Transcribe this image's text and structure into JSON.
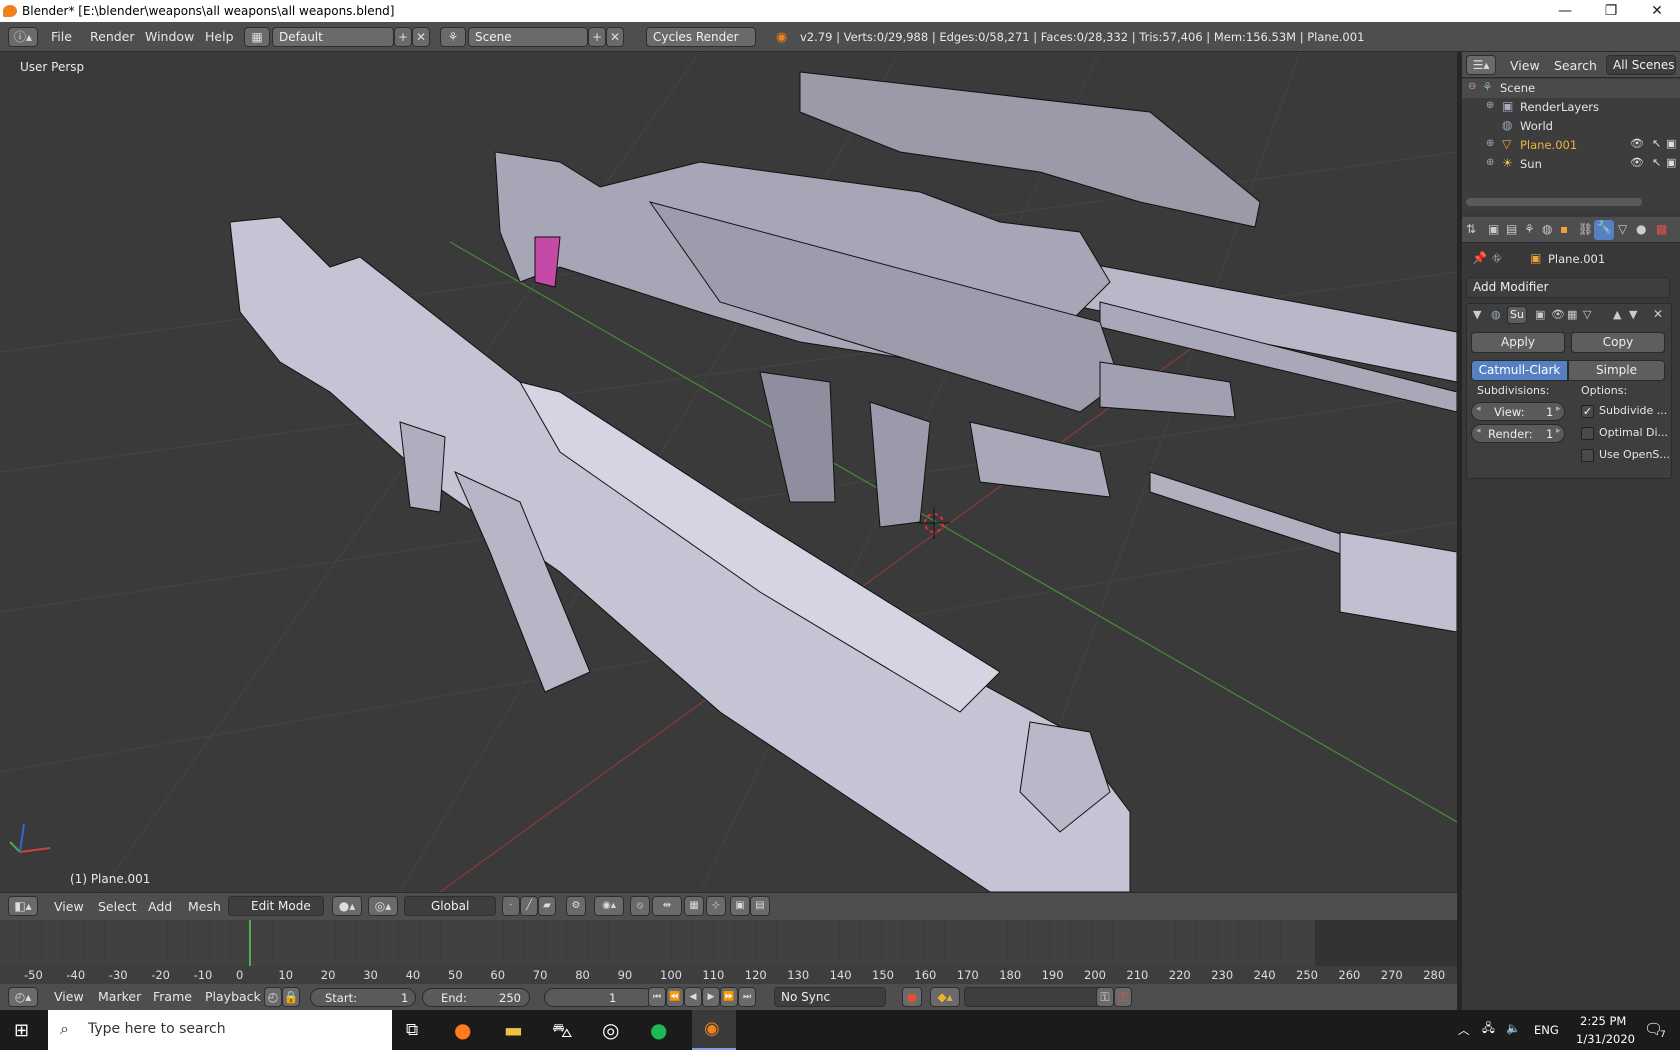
{
  "window": {
    "title": "Blender* [E:\\blender\\weapons\\all weapons\\all weapons.blend]",
    "minimize": "—",
    "maximize": "❐",
    "close": "✕"
  },
  "info_header": {
    "menus": [
      "File",
      "Render",
      "Window",
      "Help"
    ],
    "layout": "Default",
    "scene": "Scene",
    "engine": "Cycles Render",
    "stats": "v2.79 | Verts:0/29,988 | Edges:0/58,271 | Faces:0/28,332 | Tris:57,406 | Mem:156.53M | Plane.001"
  },
  "viewport": {
    "view_name": "User Persp",
    "object_label": "(1) Plane.001"
  },
  "outliner": {
    "menus": [
      "View",
      "Search"
    ],
    "filter": "All Scenes",
    "items": [
      {
        "label": "Scene",
        "icon": "scene-icon"
      },
      {
        "label": "RenderLayers",
        "icon": "render-layers-icon"
      },
      {
        "label": "World",
        "icon": "world-icon"
      },
      {
        "label": "Plane.001",
        "icon": "mesh-icon"
      },
      {
        "label": "Sun",
        "icon": "lamp-icon"
      }
    ]
  },
  "properties": {
    "object_name": "Plane.001",
    "add_modifier": "Add Modifier",
    "modifier_short_name": "Su",
    "apply": "Apply",
    "copy": "Copy",
    "tabs": [
      "Catmull-Clark",
      "Simple"
    ],
    "active_tab": "Catmull-Clark",
    "subdivisions_label": "Subdivisions:",
    "options_label": "Options:",
    "view_label": "View:",
    "view_value": "1",
    "render_label": "Render:",
    "render_value": "1",
    "options": [
      {
        "label": "Subdivide ...",
        "checked": true
      },
      {
        "label": "Optimal Di...",
        "checked": false
      },
      {
        "label": "Use OpenS...",
        "checked": false
      }
    ]
  },
  "view3d_header": {
    "menus": [
      "View",
      "Select",
      "Add",
      "Mesh"
    ],
    "mode": "Edit Mode",
    "orientation": "Global"
  },
  "timeline": {
    "ticks": [
      "-50",
      "-40",
      "-30",
      "-20",
      "-10",
      "0",
      "10",
      "20",
      "30",
      "40",
      "50",
      "60",
      "70",
      "80",
      "90",
      "100",
      "110",
      "120",
      "130",
      "140",
      "150",
      "160",
      "170",
      "180",
      "190",
      "200",
      "210",
      "220",
      "230",
      "240",
      "250",
      "260",
      "270",
      "280"
    ]
  },
  "timeline_header": {
    "menus": [
      "View",
      "Marker",
      "Frame",
      "Playback"
    ],
    "start_label": "Start:",
    "start_value": "1",
    "end_label": "End:",
    "end_value": "250",
    "current_frame": "1",
    "sync": "No Sync"
  },
  "taskbar": {
    "search_placeholder": "Type here to search",
    "language": "ENG",
    "time": "2:25 PM",
    "date": "1/31/2020",
    "notifications": "7"
  }
}
